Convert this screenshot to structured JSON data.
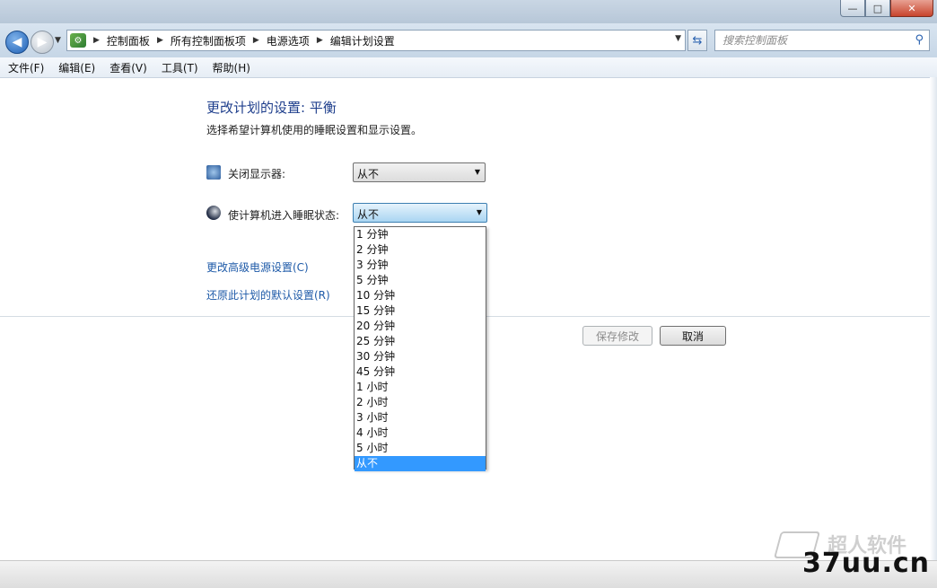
{
  "window": {
    "minimize_glyph": "—",
    "maximize_glyph": "□",
    "close_glyph": "✕"
  },
  "nav": {
    "back_icon": "arrow-left-icon",
    "forward_icon": "arrow-right-icon",
    "breadcrumbs": [
      "控制面板",
      "所有控制面板项",
      "电源选项",
      "编辑计划设置"
    ],
    "search_placeholder": "搜索控制面板"
  },
  "menu": [
    "文件(F)",
    "编辑(E)",
    "查看(V)",
    "工具(T)",
    "帮助(H)"
  ],
  "content": {
    "title": "更改计划的设置: 平衡",
    "subtitle": "选择希望计算机使用的睡眠设置和显示设置。",
    "display_label": "关闭显示器:",
    "display_value": "从不",
    "sleep_label": "使计算机进入睡眠状态:",
    "sleep_value": "从不",
    "sleep_options": [
      "1 分钟",
      "2 分钟",
      "3 分钟",
      "5 分钟",
      "10 分钟",
      "15 分钟",
      "20 分钟",
      "25 分钟",
      "30 分钟",
      "45 分钟",
      "1 小时",
      "2 小时",
      "3 小时",
      "4 小时",
      "5 小时",
      "从不"
    ],
    "selected_option": "从不",
    "advanced_link": "更改高级电源设置(C)",
    "restore_link": "还原此计划的默认设置(R)",
    "save_label": "保存修改",
    "cancel_label": "取消"
  },
  "watermark": {
    "line1": "超人软件",
    "line2": "37uu.cn"
  },
  "colors": {
    "title_blue": "#1e3e8c",
    "link_blue": "#1e5aa8",
    "selection": "#3399ff"
  }
}
